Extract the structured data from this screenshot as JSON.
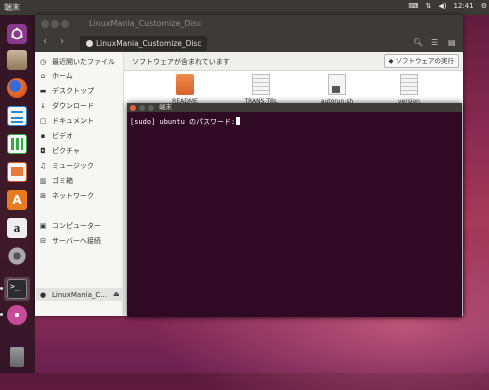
{
  "top_panel": {
    "app_title": "端末",
    "time": "12:41"
  },
  "launcher": {
    "items": [
      {
        "name": "dash",
        "icon": "ubuntu-logo-icon",
        "color": "#8a3a8c"
      },
      {
        "name": "files",
        "icon": "file-manager-icon",
        "color": "#a08a6a"
      },
      {
        "name": "firefox",
        "icon": "firefox-icon",
        "color": "#e0702a"
      },
      {
        "name": "writer",
        "icon": "writer-icon",
        "color": "#2a8ad0"
      },
      {
        "name": "calc",
        "icon": "calc-icon",
        "color": "#3aa848"
      },
      {
        "name": "impress",
        "icon": "impress-icon",
        "color": "#d05a2a"
      },
      {
        "name": "software-center",
        "icon": "software-center-icon",
        "color": "#e87a20"
      },
      {
        "name": "amazon",
        "icon": "amazon-icon",
        "color": "#e8e8e8"
      },
      {
        "name": "settings",
        "icon": "settings-icon",
        "color": "#9a9a9a"
      },
      {
        "name": "terminal",
        "icon": "terminal-icon",
        "color": "#2c2c2c"
      },
      {
        "name": "disc",
        "icon": "optical-disc-icon",
        "color": "#c84a9a"
      },
      {
        "name": "trash",
        "icon": "trash-icon",
        "color": "#7a7a7a"
      }
    ]
  },
  "nautilus": {
    "title": "LinuxMania_Customize_Disc",
    "breadcrumb": "LinuxMania_Customize_Disc",
    "sidebar": [
      {
        "label": "最近開いたファイル",
        "icon": "◷"
      },
      {
        "label": "ホーム",
        "icon": "⌂"
      },
      {
        "label": "デスクトップ",
        "icon": "▬"
      },
      {
        "label": "ダウンロード",
        "icon": "↓"
      },
      {
        "label": "ドキュメント",
        "icon": "▢"
      },
      {
        "label": "ビデオ",
        "icon": "▪"
      },
      {
        "label": "ピクチャ",
        "icon": "◘"
      },
      {
        "label": "ミュージック",
        "icon": "♫"
      },
      {
        "label": "ゴミ箱",
        "icon": "▥"
      },
      {
        "label": "ネットワーク",
        "icon": "⊞"
      },
      {
        "label": "LinuxMania_C...",
        "icon": "●"
      },
      {
        "label": "コンピューター",
        "icon": "▣"
      },
      {
        "label": "サーバーへ接続",
        "icon": "⊟"
      }
    ],
    "infobar": {
      "text": "ソフトウェアが含まれています",
      "run_button": "ソフトウェアの実行"
    },
    "files": [
      {
        "name": "README",
        "kind": "folder"
      },
      {
        "name": "TRANS.TBL",
        "kind": "text"
      },
      {
        "name": "autorun.sh",
        "kind": "script"
      },
      {
        "name": "version",
        "kind": "text"
      }
    ]
  },
  "terminal": {
    "title": "端末",
    "prompt": "[sudo] ubuntu のパスワード:"
  }
}
